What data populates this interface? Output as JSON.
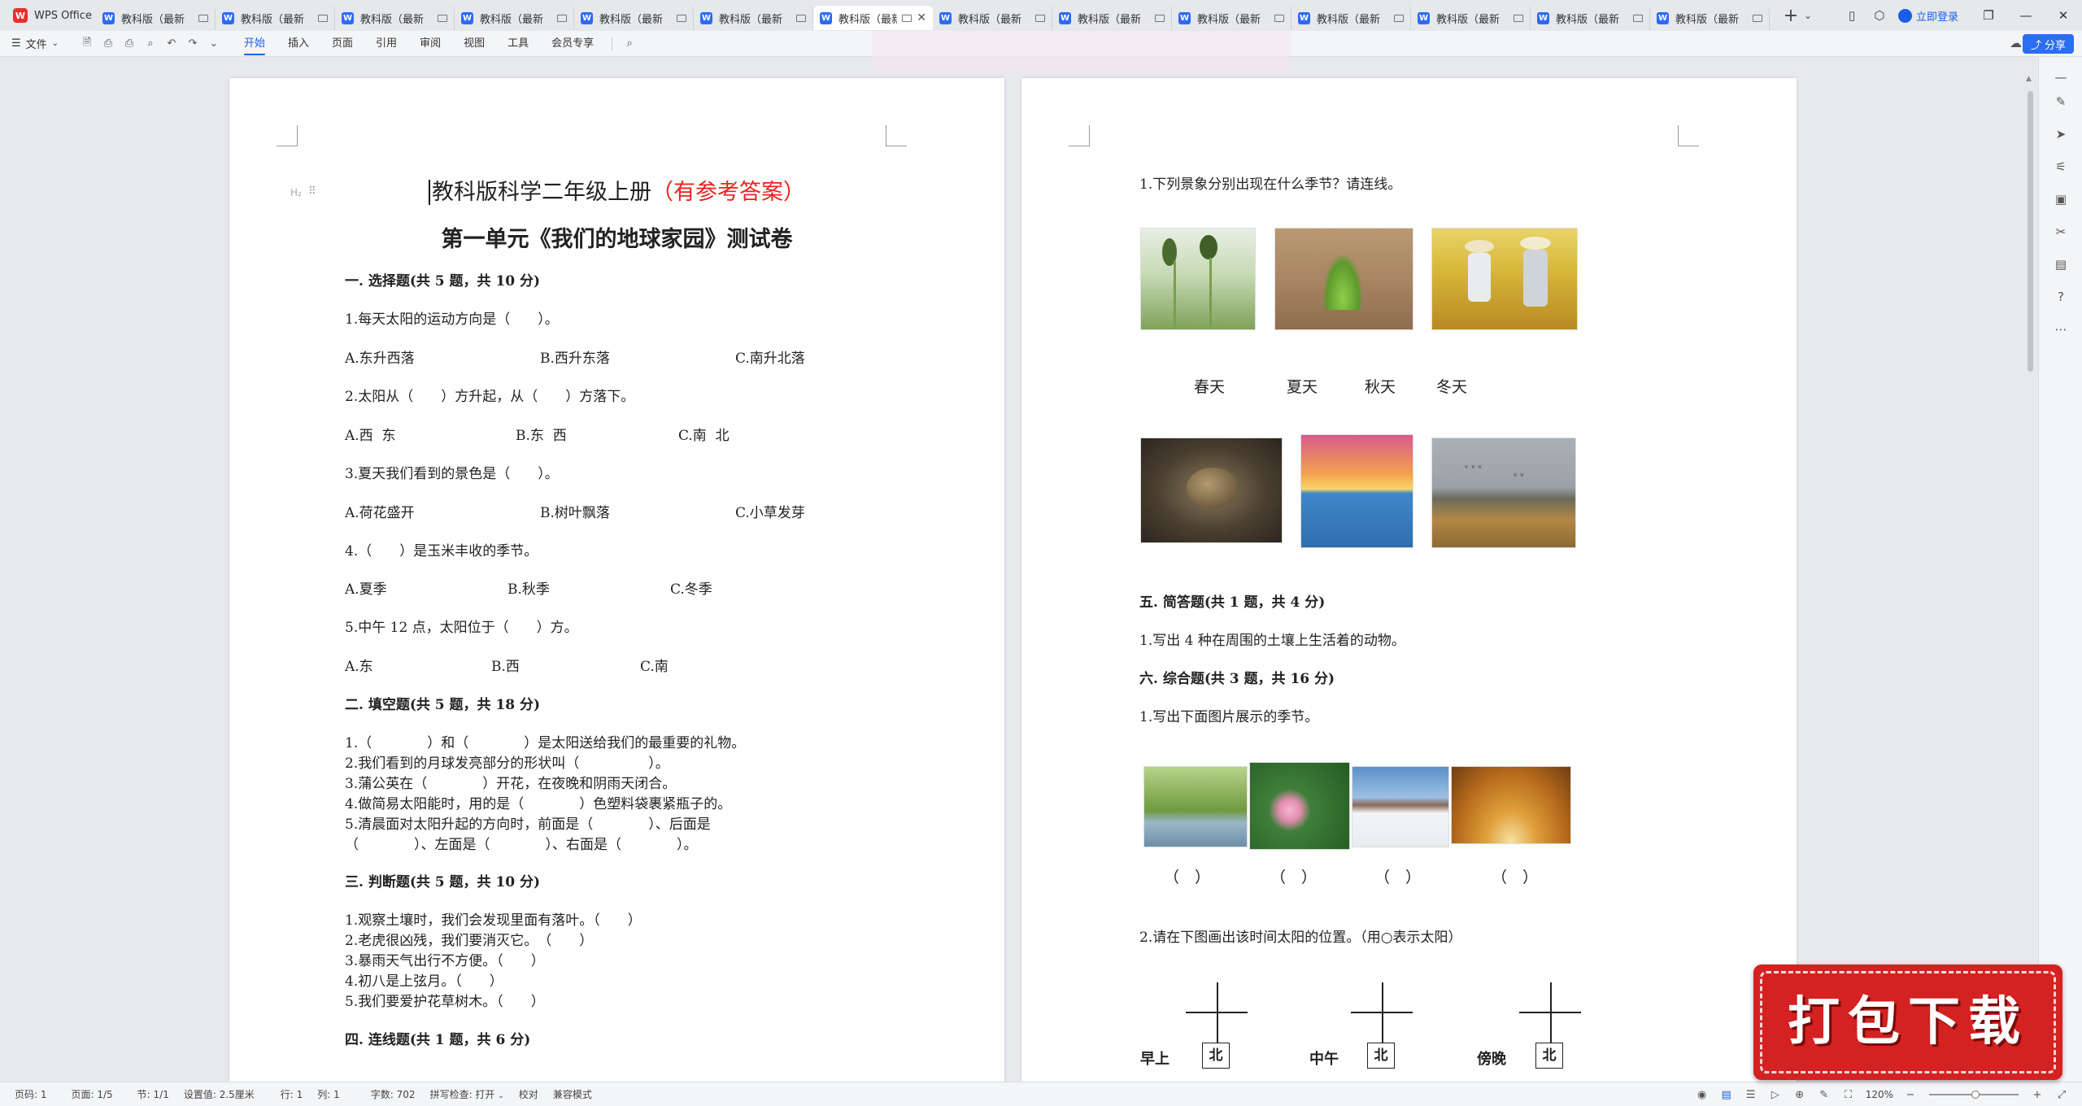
{
  "app": {
    "name": "WPS Office"
  },
  "tabs": [
    {
      "label": "教科版（最新"
    },
    {
      "label": "教科版（最新"
    },
    {
      "label": "教科版（最新"
    },
    {
      "label": "教科版（最新"
    },
    {
      "label": "教科版（最新"
    },
    {
      "label": "教科版（最新"
    },
    {
      "label": "教科版（最新"
    },
    {
      "label": "教科版（最新"
    },
    {
      "label": "教科版（最新"
    },
    {
      "label": "教科版（最新"
    },
    {
      "label": "教科版（最新"
    },
    {
      "label": "教科版（最新"
    },
    {
      "label": "教科版（最新"
    },
    {
      "label": "教科版（最新"
    }
  ],
  "active_tab_index": 6,
  "titlebar": {
    "login_label": "立即登录"
  },
  "ribbon": {
    "file_label": "文件",
    "tabs": [
      "开始",
      "插入",
      "页面",
      "引用",
      "审阅",
      "视图",
      "工具",
      "会员专享"
    ],
    "active_tab": "开始",
    "share_label": "分享"
  },
  "page1": {
    "title_main": "教科版科学二年级上册",
    "title_note": "（有参考答案）",
    "subtitle": "第一单元《我们的地球家园》测试卷",
    "heading_hint": "H₂",
    "sections": [
      {
        "id": "s1",
        "title": "一. 选择题(共 5 题，共 10 分)"
      },
      {
        "id": "s2",
        "title": "二. 填空题(共 5 题，共 18 分)"
      },
      {
        "id": "s3",
        "title": "三. 判断题(共 5 题，共 10 分)"
      },
      {
        "id": "s4",
        "title": "四. 连线题(共 1 题，共 6 分)"
      }
    ],
    "choice": [
      {
        "q": "1.每天太阳的运动方向是（　　）。",
        "opts": [
          "A.东升西落",
          "B.西升东落",
          "C.南升北落"
        ]
      },
      {
        "q": "2.太阳从（　　）方升起，从（　　）方落下。",
        "opts": [
          "A.西  东",
          "B.东  西",
          "C.南  北"
        ]
      },
      {
        "q": "3.夏天我们看到的景色是（　　）。",
        "opts": [
          "A.荷花盛开",
          "B.树叶飘落",
          "C.小草发芽"
        ]
      },
      {
        "q": "4.（　　）是玉米丰收的季节。",
        "opts": [
          "A.夏季",
          "B.秋季",
          "C.冬季"
        ]
      },
      {
        "q": "5.中午 12 点，太阳位于（　　）方。",
        "opts": [
          "A.东",
          "B.西",
          "C.南"
        ]
      }
    ],
    "fill": [
      "1.（　　　　）和（　　　　）是太阳送给我们的最重要的礼物。",
      "2.我们看到的月球发亮部分的形状叫（　　　　　）。",
      "3.蒲公英在（　　　　）开花，在夜晚和阴雨天闭合。",
      "4.做简易太阳能时，用的是（　　　　）色塑料袋裹紧瓶子的。",
      "5.清晨面对太阳升起的方向时，前面是（　　　　）、后面是",
      "（　　　　）、左面是（　　　　）、右面是（　　　　）。"
    ],
    "judge": [
      "1.观察土壤时，我们会发现里面有落叶。（　　）",
      "2.老虎很凶残，我们要消灭它。　（　　）",
      "3.暴雨天气出行不方便。（　　）",
      "4.初八是上弦月。（　　）",
      "5.我们要爱护花草树木。（　　）"
    ]
  },
  "page2": {
    "q_connect": "1.下列景象分别出现在什么季节？请连线。",
    "seasons": [
      "春天",
      "夏天",
      "秋天",
      "冬天"
    ],
    "section5": "五. 简答题(共 1 题，共 4 分)",
    "q5": "1.写出 4 种在周围的土壤上生活着的动物。",
    "section6": "六. 综合题(共 3 题，共 16 分)",
    "q6_1": "1.写出下面图片展示的季节。",
    "paren_blank": "（　）",
    "q6_2": "2.请在下图画出该时间太阳的位置。（用○表示太阳）",
    "times": [
      "早上",
      "中午",
      "傍晚"
    ],
    "north": "北"
  },
  "status": {
    "page_no": "页码: 1",
    "page_count": "页面: 1/5",
    "section": "节: 1/1",
    "setting": "设置值: 2.5厘米",
    "row": "行: 1",
    "col": "列: 1",
    "words": "字数: 702",
    "spell": "拼写检查: 打开",
    "proof": "校对",
    "compat": "兼容模式",
    "zoom": "120%"
  },
  "banner": {
    "text": "打包下载"
  },
  "colors": {
    "accent": "#1a5ee8",
    "title_red": "#e8231c",
    "banner_red": "#d42121"
  }
}
